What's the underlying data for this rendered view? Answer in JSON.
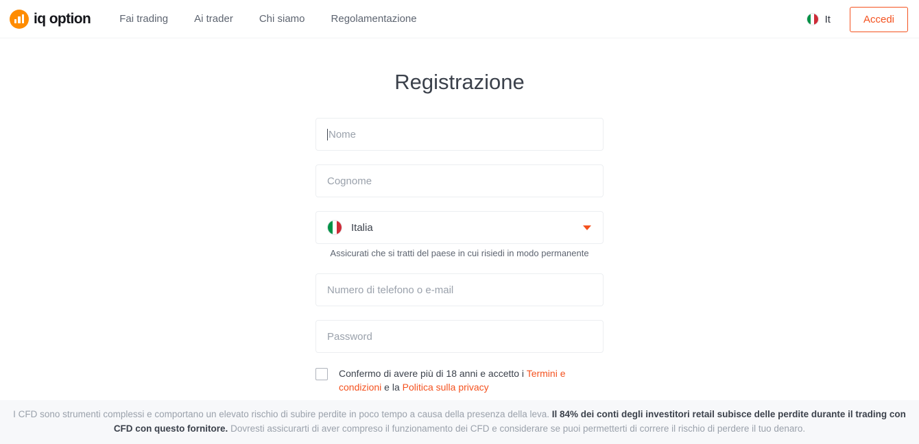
{
  "header": {
    "logo": {
      "icon": "bar-chart-circle-icon",
      "text": "iq option"
    },
    "nav": [
      {
        "label": "Fai trading"
      },
      {
        "label": "Ai trader"
      },
      {
        "label": "Chi siamo"
      },
      {
        "label": "Regolamentazione"
      }
    ],
    "language": {
      "icon": "italy-flag-icon",
      "label": "It"
    },
    "login_label": "Accedi"
  },
  "main": {
    "title": "Registrazione",
    "fields": {
      "first_name": {
        "placeholder": "Nome",
        "value": "",
        "focused": true
      },
      "last_name": {
        "placeholder": "Cognome",
        "value": ""
      },
      "country": {
        "value": "Italia",
        "flag": "italy-flag-icon",
        "chevron": "chevron-down-icon"
      },
      "country_helper": "Assicurati che si tratti del paese in cui risiedi in modo permanente",
      "contact": {
        "placeholder": "Numero di telefono o e-mail",
        "value": ""
      },
      "password": {
        "placeholder": "Password",
        "value": ""
      }
    },
    "terms": {
      "checked": false,
      "text_part1": "Confermo di avere più di 18 anni e accetto i ",
      "link1": "Termini e condizioni",
      "text_part2": " e la ",
      "link2": "Politica sulla privacy"
    }
  },
  "disclaimer": {
    "part1": "I CFD sono strumenti complessi e comportano un elevato rischio di subire perdite in poco tempo a causa della presenza della leva. ",
    "bold1": "Il 84% dei conti degli investitori retail subisce delle perdite durante il trading con CFD con questo fornitore.",
    "part2": " Dovresti assicurarti di aver compreso il funzionamento dei CFD e considerare se puoi permetterti di correre il rischio di perdere il tuo denaro."
  },
  "colors": {
    "brand_orange": "#f4511e",
    "logo_orange": "#ff8c00",
    "text_dark": "#3b414b",
    "text_muted": "#9aa1ab",
    "disclaimer_bg": "#f7f8fa"
  }
}
